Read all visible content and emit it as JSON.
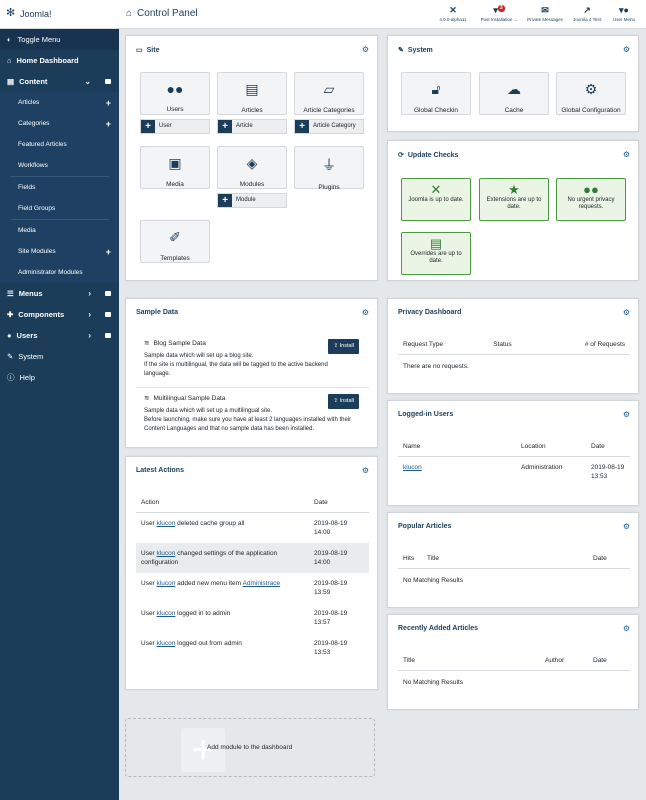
{
  "header": {
    "logo_text": "Joomla!",
    "title": "Control Panel",
    "items": [
      {
        "label": "4.0.0-alpha11",
        "icon": "joomla-icon"
      },
      {
        "label": "Post Installation ...",
        "icon": "bell-icon",
        "badge": "3"
      },
      {
        "label": "Private Messages",
        "icon": "envelope-icon"
      },
      {
        "label": "Joomla 4 Test",
        "icon": "external-link-icon"
      },
      {
        "label": "User Menu",
        "icon": "user-circle-icon"
      }
    ]
  },
  "sidebar": {
    "toggle": "Toggle Menu",
    "home": "Home Dashboard",
    "content": "Content",
    "content_items": [
      "Articles",
      "Categories",
      "Featured Articles",
      "Workflows",
      "Fields",
      "Field Groups",
      "Media",
      "Site Modules",
      "Administrator Modules"
    ],
    "menus": "Menus",
    "components": "Components",
    "users": "Users",
    "system": "System",
    "help": "Help"
  },
  "site": {
    "title": "Site",
    "tiles": [
      "Users",
      "Articles",
      "Article Categories",
      "Media",
      "Modules",
      "Plugins",
      "Templates"
    ],
    "add_user": "User",
    "add_article": "Article",
    "add_category": "Article Category",
    "add_module": "Module"
  },
  "system": {
    "title": "System",
    "tiles": [
      "Global Checkin",
      "Cache",
      "Global Configuration"
    ]
  },
  "update_checks": {
    "title": "Update Checks",
    "tiles": [
      "Joomla is up to date.",
      "Extensions are up to date.",
      "No urgent privacy requests.",
      "Overrides are up to date."
    ]
  },
  "sample_data": {
    "title": "Sample Data",
    "items": [
      {
        "name": "Blog Sample Data",
        "install": "Install",
        "desc1": "Sample data which will set up a blog site.",
        "desc2": "If the site is multilingual, the data will be tagged to the active backend",
        "desc3": "language."
      },
      {
        "name": "Multilingual Sample Data",
        "install": "Install",
        "desc1": "Sample data which will set up a multilingual site.",
        "desc2": "Before launching, make sure you have at least 2 languages installed with their",
        "desc3": "Content Languages and that no sample data has been installed."
      }
    ]
  },
  "privacy": {
    "title": "Privacy Dashboard",
    "col_type": "Request Type",
    "col_status": "Status",
    "col_count": "# of Requests",
    "empty": "There are no requests."
  },
  "logged_in": {
    "title": "Logged-in Users",
    "col_name": "Name",
    "col_location": "Location",
    "col_date": "Date",
    "row": {
      "name": "klucon",
      "location": "Administration",
      "date1": "2019-08-19",
      "date2": "13:53"
    }
  },
  "latest_actions": {
    "title": "Latest Actions",
    "col_action": "Action",
    "col_date": "Date",
    "rows": [
      {
        "pre": "User ",
        "link": "klucon",
        "post": " deleted cache group all",
        "link2": "",
        "post2": "",
        "date1": "2019-08-19",
        "date2": "14:00"
      },
      {
        "pre": "User ",
        "link": "klucon",
        "post": " changed settings of the application configuration",
        "link2": "",
        "post2": "",
        "date1": "2019-08-19",
        "date2": "14:00"
      },
      {
        "pre": "User ",
        "link": "klucon",
        "post": " added new menu item ",
        "link2": "Administrace",
        "post2": "",
        "date1": "2019-08-19",
        "date2": "13:59"
      },
      {
        "pre": "User ",
        "link": "klucon",
        "post": " logged in to admin",
        "link2": "",
        "post2": "",
        "date1": "2019-08-19",
        "date2": "13:57"
      },
      {
        "pre": "User ",
        "link": "klucon",
        "post": " logged out from admin",
        "link2": "",
        "post2": "",
        "date1": "2019-08-19",
        "date2": "13:53"
      }
    ]
  },
  "popular": {
    "title": "Popular Articles",
    "col_hits": "Hits",
    "col_title": "Title",
    "col_date": "Date",
    "empty": "No Matching Results"
  },
  "recent": {
    "title": "Recently Added Articles",
    "col_title": "Title",
    "col_author": "Author",
    "col_date": "Date",
    "empty": "No Matching Results"
  },
  "add_module": "Add module to the dashboard"
}
